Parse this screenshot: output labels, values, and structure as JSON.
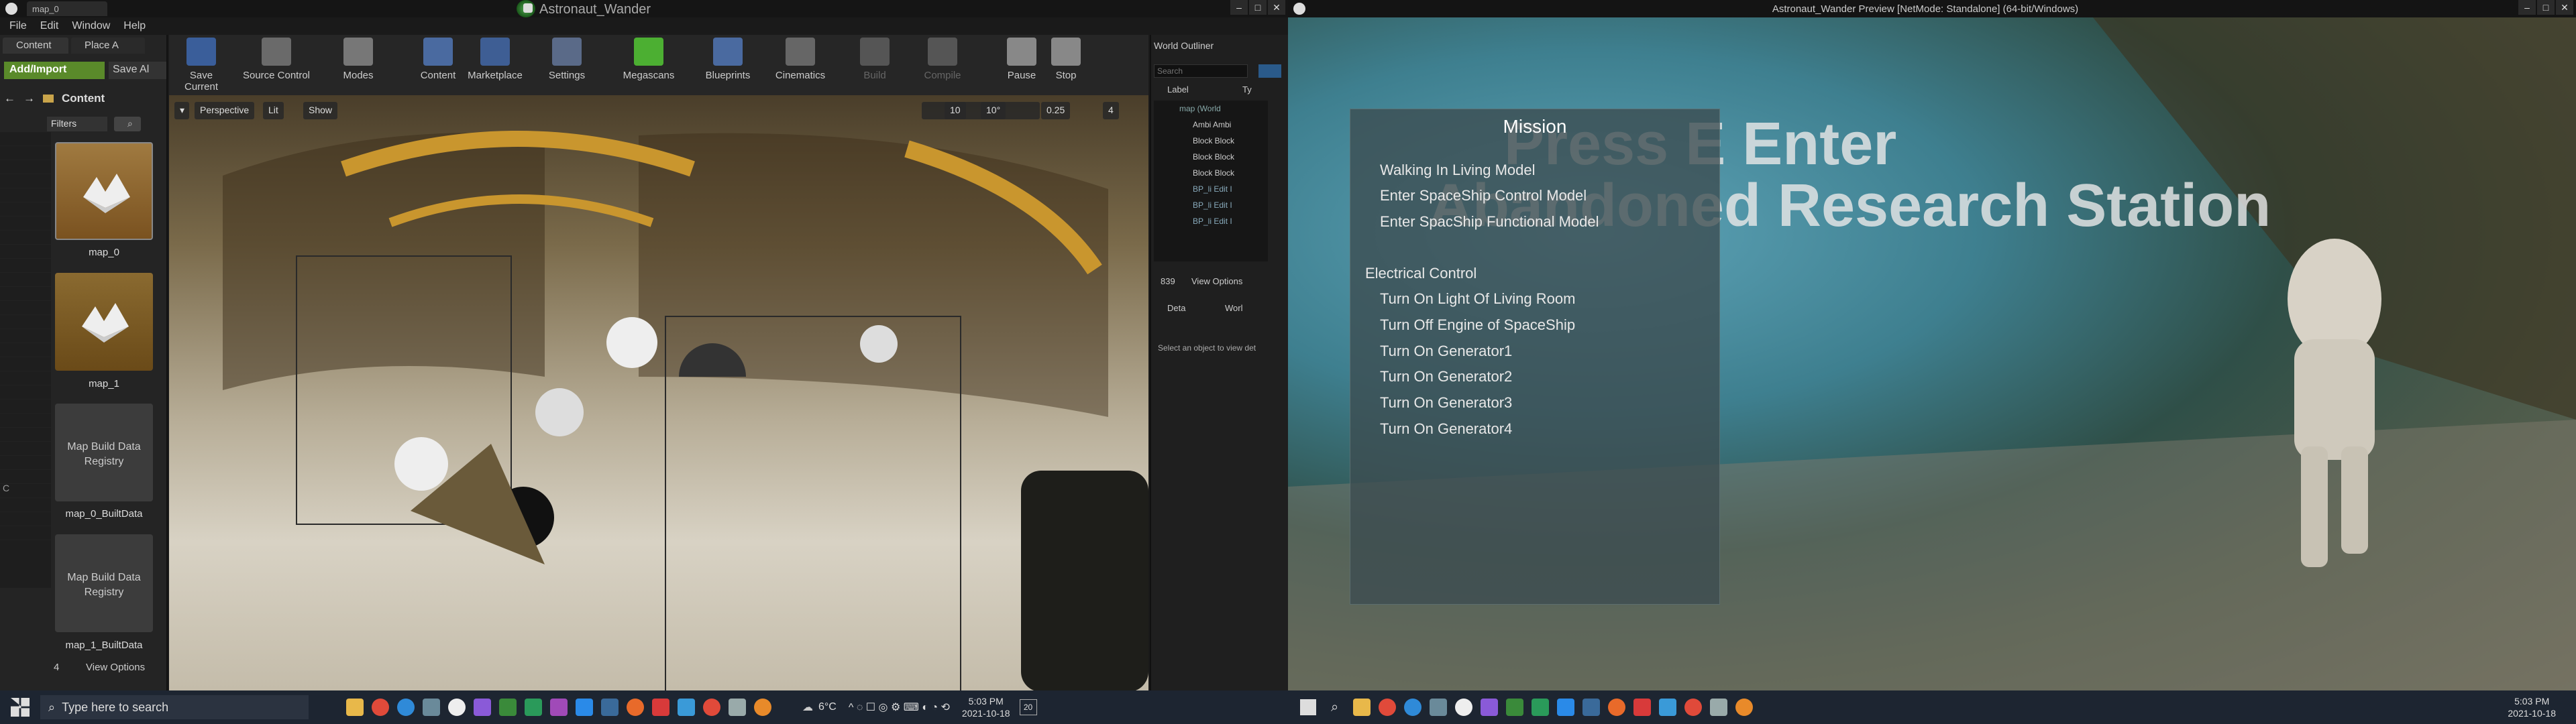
{
  "editor": {
    "tab_title": "map_0",
    "project_name": "Astronaut_Wander",
    "menu": [
      "File",
      "Edit",
      "Window",
      "Help"
    ],
    "content_tab": "Content",
    "place_tab": "Place A",
    "add_import": "Add/Import",
    "save_all": "Save Al",
    "path_label": "Content",
    "filters": "Filters",
    "tree_root": "C",
    "tree_bottom": "C",
    "assets": [
      {
        "label": "map_0",
        "type": "level"
      },
      {
        "label": "map_1",
        "type": "level"
      },
      {
        "label": "map_0_BuiltData",
        "thumb": "Map Build Data Registry"
      },
      {
        "label": "map_1_BuiltData",
        "thumb": "Map Build Data Registry"
      }
    ],
    "asset_count": "4",
    "view_options": "View Options",
    "toolbar": [
      "Save Current",
      "Source Control",
      "Modes",
      "Content",
      "Marketplace",
      "Settings",
      "Megascans",
      "Blueprints",
      "Cinematics",
      "Build",
      "Compile",
      "Pause",
      "Stop"
    ],
    "viewport": {
      "perspective": "Perspective",
      "lit": "Lit",
      "show": "Show",
      "grid": "10",
      "rot": "10°",
      "scale": "0.25",
      "speed": "4"
    },
    "outliner": {
      "title": "World Outliner",
      "search_placeholder": "Search",
      "col_label": "Label",
      "col_type": "Ty",
      "items": [
        "map (World",
        "Ambi Ambi",
        "Block Block",
        "Block Block",
        "Block Block",
        "BP_li Edit I",
        "BP_li Edit I",
        "BP_li Edit I"
      ],
      "count": "839",
      "view_options": "View Options",
      "details_tab": "Deta",
      "world_tab": "Worl",
      "details_hint": "Select an object to view det"
    }
  },
  "game": {
    "title": "Astronaut_Wander Preview [NetMode: Standalone] (64-bit/Windows)",
    "mission_title": "Mission",
    "items": [
      {
        "text": "Walking In Living Model",
        "level": 1,
        "state": "normal"
      },
      {
        "text": "Enter SpaceShip Control Model",
        "level": 1,
        "state": "normal"
      },
      {
        "text": "Enter SpacShip Functional Model",
        "level": 1,
        "state": "normal"
      },
      {
        "text": "Electrical Control",
        "level": 0,
        "state": "normal"
      },
      {
        "text": "Turn On Light Of Living Room",
        "level": 1,
        "state": "normal"
      },
      {
        "text": "Turn Off Engine of SpaceShip",
        "level": 1,
        "state": "normal"
      },
      {
        "text": "Turn On Generator1",
        "level": 1,
        "state": "normal"
      },
      {
        "text": "Turn On Generator2",
        "level": 1,
        "state": "normal"
      },
      {
        "text": "Turn On Generator3",
        "level": 1,
        "state": "normal"
      },
      {
        "text": "Turn On Generator4",
        "level": 1,
        "state": "normal"
      }
    ],
    "press_text": "Press E Enter",
    "station_text": "Abandoned Research Station"
  },
  "taskbar_left": {
    "search": "Type here to search",
    "weather": "6°C",
    "time": "5:03 PM",
    "date": "2021-10-18",
    "notif": "20"
  },
  "taskbar_right": {
    "time": "5:03 PM",
    "date": "2021-10-18"
  },
  "colors": {
    "ue_green": "#5a8a2a",
    "accent": "#0e7a0d",
    "mission_bg": "#3c4b50"
  }
}
